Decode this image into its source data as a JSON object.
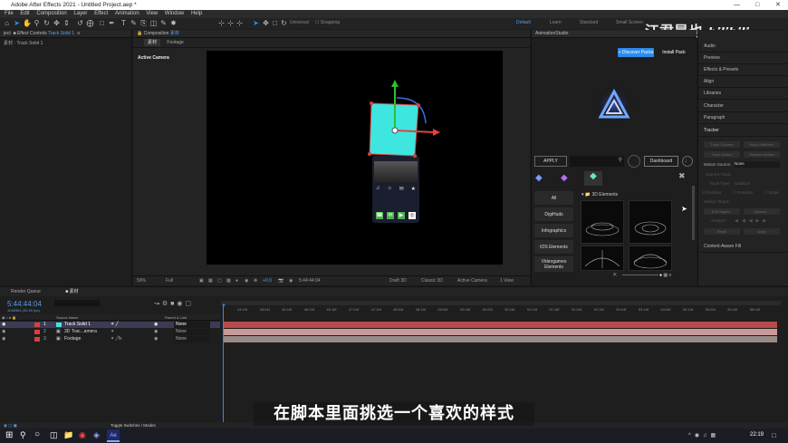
{
  "app": {
    "title": "Adobe After Effects 2021 - Untitled Project.aep *"
  },
  "menu": [
    "File",
    "Edit",
    "Composition",
    "Layer",
    "Effect",
    "Animation",
    "View",
    "Window",
    "Help"
  ],
  "toolbar": {
    "universal": "Universal",
    "snapping": "Snapping",
    "workspaces": [
      "Default",
      "Learn",
      "Standard",
      "Small Screen"
    ]
  },
  "left_panel": {
    "tab_project": "ject",
    "tab_effect_controls": "Effect Controls",
    "effect_layer": "Track Solid 1",
    "layer_path": "素材 · Track Solid 1"
  },
  "comp_panel": {
    "tab": "Composition",
    "comp_name": "素材",
    "sub_tab_1": "素材",
    "sub_tab_2": "Footage",
    "active_camera_label": "Active Camera",
    "footer": {
      "zoom": "59%",
      "quality": "Full",
      "exposure": "+0.0",
      "timecode": "5:44:44:04",
      "renderer": "Draft 3D",
      "renderer_mode": "Classic 3D",
      "camera": "Active Camera",
      "views": "1 View"
    }
  },
  "animation_studio": {
    "title": "AnimationStudio",
    "discover_packs": "+ Discover Packs",
    "install_pack": "Install Pack",
    "apply": "APPLY",
    "dashboard": "Dashboard",
    "category_header": "3D Elements",
    "categories": [
      "All",
      "DigiHuds",
      "Infographics",
      "IOS Elements",
      "Videogames Elements"
    ]
  },
  "right_panel": {
    "items": [
      "Audio",
      "Preview",
      "Effects & Presets",
      "Align",
      "Libraries",
      "Character",
      "Paragraph",
      "Tracker"
    ],
    "tracker": {
      "track_camera": "Track Camera",
      "warp_stabilizer": "Warp Stabilizer",
      "track_motion": "Track Motion",
      "stabilize_motion": "Stabilize Motion",
      "motion_source_label": "Motion Source:",
      "motion_source_value": "None",
      "current_track": "Current Track:",
      "track_type": "Track Type:",
      "track_type_value": "Stabilize",
      "position": "Position",
      "rotation": "Rotation",
      "scale": "Scale",
      "motion_target": "Motion Target:",
      "edit_target": "Edit Target...",
      "options": "Options...",
      "analyze": "Analyze:",
      "reset": "Reset",
      "apply": "Apply"
    },
    "content_aware": "Content-Aware Fill"
  },
  "timeline": {
    "render_queue": "Render Queue",
    "comp_tab": "素材",
    "current_time": "5:44:44:04",
    "frame_info": "1046364 (30.00 fps)",
    "col_source": "Source Name",
    "col_parent": "Parent & Link",
    "ruler": [
      "44:16f",
      "45:04f",
      "45:16f",
      "46:04f",
      "46:16f",
      "47:04f",
      "47:16f",
      "48:04f",
      "48:16f",
      "49:04f",
      "49:16f",
      "50:04f",
      "50:16f",
      "51:04f",
      "51:16f",
      "52:04f",
      "52:16f",
      "53:04f",
      "53:16f",
      "54:04f",
      "54:16f",
      "55:04f",
      "55:16f",
      "56:04f"
    ],
    "layers": [
      {
        "num": "1",
        "name": "Track Solid 1",
        "parent": "None"
      },
      {
        "num": "2",
        "name": "3D Trac...amera",
        "parent": "None"
      },
      {
        "num": "3",
        "name": "Footage",
        "parent": "None"
      }
    ],
    "toggle_label": "Toggle Switches / Modes"
  },
  "phone_icons": {
    "row1": [
      "♫",
      "☼",
      "✉",
      "★"
    ],
    "dock": [
      "☎",
      "✉",
      "▶",
      "◎"
    ]
  },
  "subtitle": "在脚本里面挑选一个喜欢的样式",
  "watermark": {
    "name": "江君是也",
    "site": "bilibili"
  },
  "taskbar": {
    "time": "22:19"
  },
  "colors": {
    "accent": "#2d8ceb",
    "selected_bar": "#b94a4a",
    "cyan": "#3ee6e0",
    "track_green": "#4caf50"
  }
}
